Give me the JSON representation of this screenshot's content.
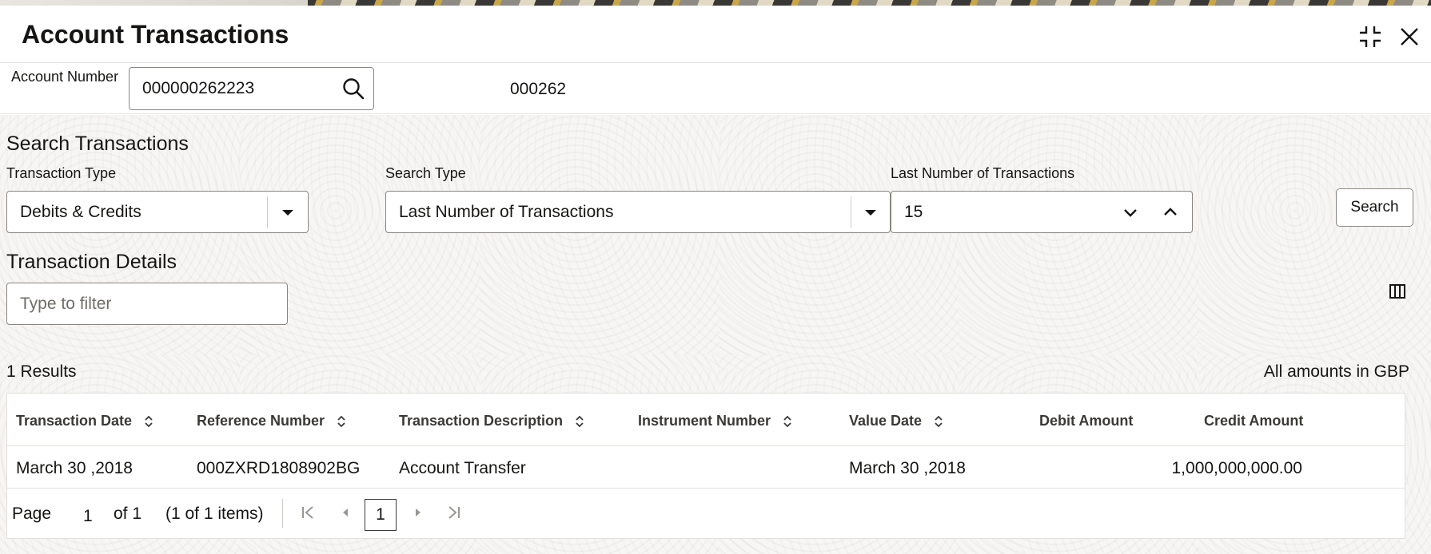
{
  "header": {
    "title": "Account Transactions",
    "icons": [
      "minimize-icon",
      "close-icon"
    ]
  },
  "account": {
    "label": "Account Number",
    "value": "000000262223",
    "code": "000262",
    "icon": "search-icon"
  },
  "search": {
    "section_title": "Search Transactions",
    "transaction_type": {
      "label": "Transaction Type",
      "value": "Debits & Credits"
    },
    "search_type": {
      "label": "Search Type",
      "value": "Last Number of Transactions"
    },
    "last_number": {
      "label": "Last Number of Transactions",
      "value": "15"
    },
    "button_label": "Search"
  },
  "details": {
    "section_title": "Transaction Details",
    "filter_placeholder": "Type to filter",
    "results_count": "1 Results",
    "amounts_note": "All amounts in GBP"
  },
  "table": {
    "columns": [
      {
        "label": "Transaction Date",
        "sortable": true
      },
      {
        "label": "Reference Number",
        "sortable": true
      },
      {
        "label": "Transaction Description",
        "sortable": true
      },
      {
        "label": "Instrument Number",
        "sortable": true
      },
      {
        "label": "Value Date",
        "sortable": true
      },
      {
        "label": "Debit Amount",
        "sortable": false
      },
      {
        "label": "Credit Amount",
        "sortable": false
      }
    ],
    "rows": [
      {
        "transaction_date": "March 30 ,2018",
        "reference_number": "000ZXRD1808902BG",
        "description": "Account Transfer",
        "instrument_number": "",
        "value_date": "March 30 ,2018",
        "debit_amount": "",
        "credit_amount": "1,000,000,000.00"
      }
    ]
  },
  "pagination": {
    "page_label": "Page",
    "page_value": "1",
    "of_label": "of 1",
    "items_label": "(1 of 1 items)",
    "current_page": "1"
  }
}
